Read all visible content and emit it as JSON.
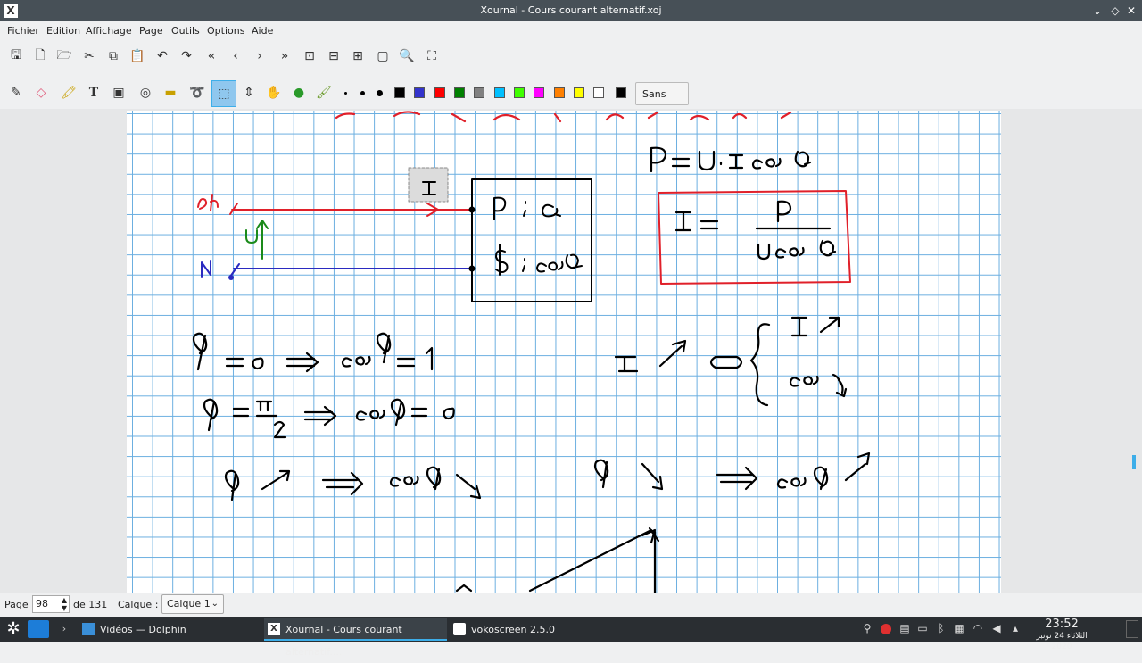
{
  "window": {
    "title": "Xournal - Cours courant alternatif.xoj"
  },
  "menu": [
    "Fichier",
    "Edition",
    "Affichage",
    "Page",
    "Outils",
    "Options",
    "Aide"
  ],
  "font": {
    "name": "Sans",
    "size": "12"
  },
  "status": {
    "page_label": "Page",
    "page_value": "98",
    "of_label": "de 131",
    "layer_label": "Calque :",
    "layer_value": "Calque 1"
  },
  "taskbar": {
    "tasks": [
      {
        "label": "Vidéos — Dolphin"
      },
      {
        "label": "Xournal - Cours courant alternatif...."
      },
      {
        "label": "vokoscreen 2.5.0"
      }
    ],
    "time": "23:52",
    "date": "الثلاثاء 24 نونبر 2020"
  },
  "colors": {
    "accent": "#3daee9",
    "ink_red": "#e0202a",
    "ink_blue": "#2a2ac0",
    "ink_green": "#1a8a1a",
    "grid": "#6aaee0"
  },
  "icons": {
    "toolbar1": [
      "save-icon",
      "new-document-icon",
      "open-folder-icon",
      "cut-icon",
      "copy-icon",
      "paste-icon",
      "undo-icon",
      "redo-icon",
      "first-page-icon",
      "previous-page-icon",
      "next-page-icon",
      "last-page-icon",
      "zoom-fit-icon",
      "zoom-out-icon",
      "zoom-in-icon",
      "zoom-page-icon",
      "search-icon",
      "fullscreen-icon"
    ],
    "toolbar2": [
      "pen-icon",
      "eraser-icon",
      "highlighter-icon",
      "text-icon",
      "image-icon",
      "shape-recognizer-icon",
      "ruler-icon",
      "lasso-icon",
      "rectangle-select-icon",
      "vertical-space-icon",
      "hand-icon",
      "default-tool-icon",
      "fill-icon"
    ]
  },
  "palette": [
    "#000000",
    "#3333cc",
    "#ff0000",
    "#008000",
    "#808080",
    "#00c0ff",
    "#40ff00",
    "#ff00ff",
    "#ff8000",
    "#ffff00",
    "#ffffff",
    "#000000"
  ]
}
